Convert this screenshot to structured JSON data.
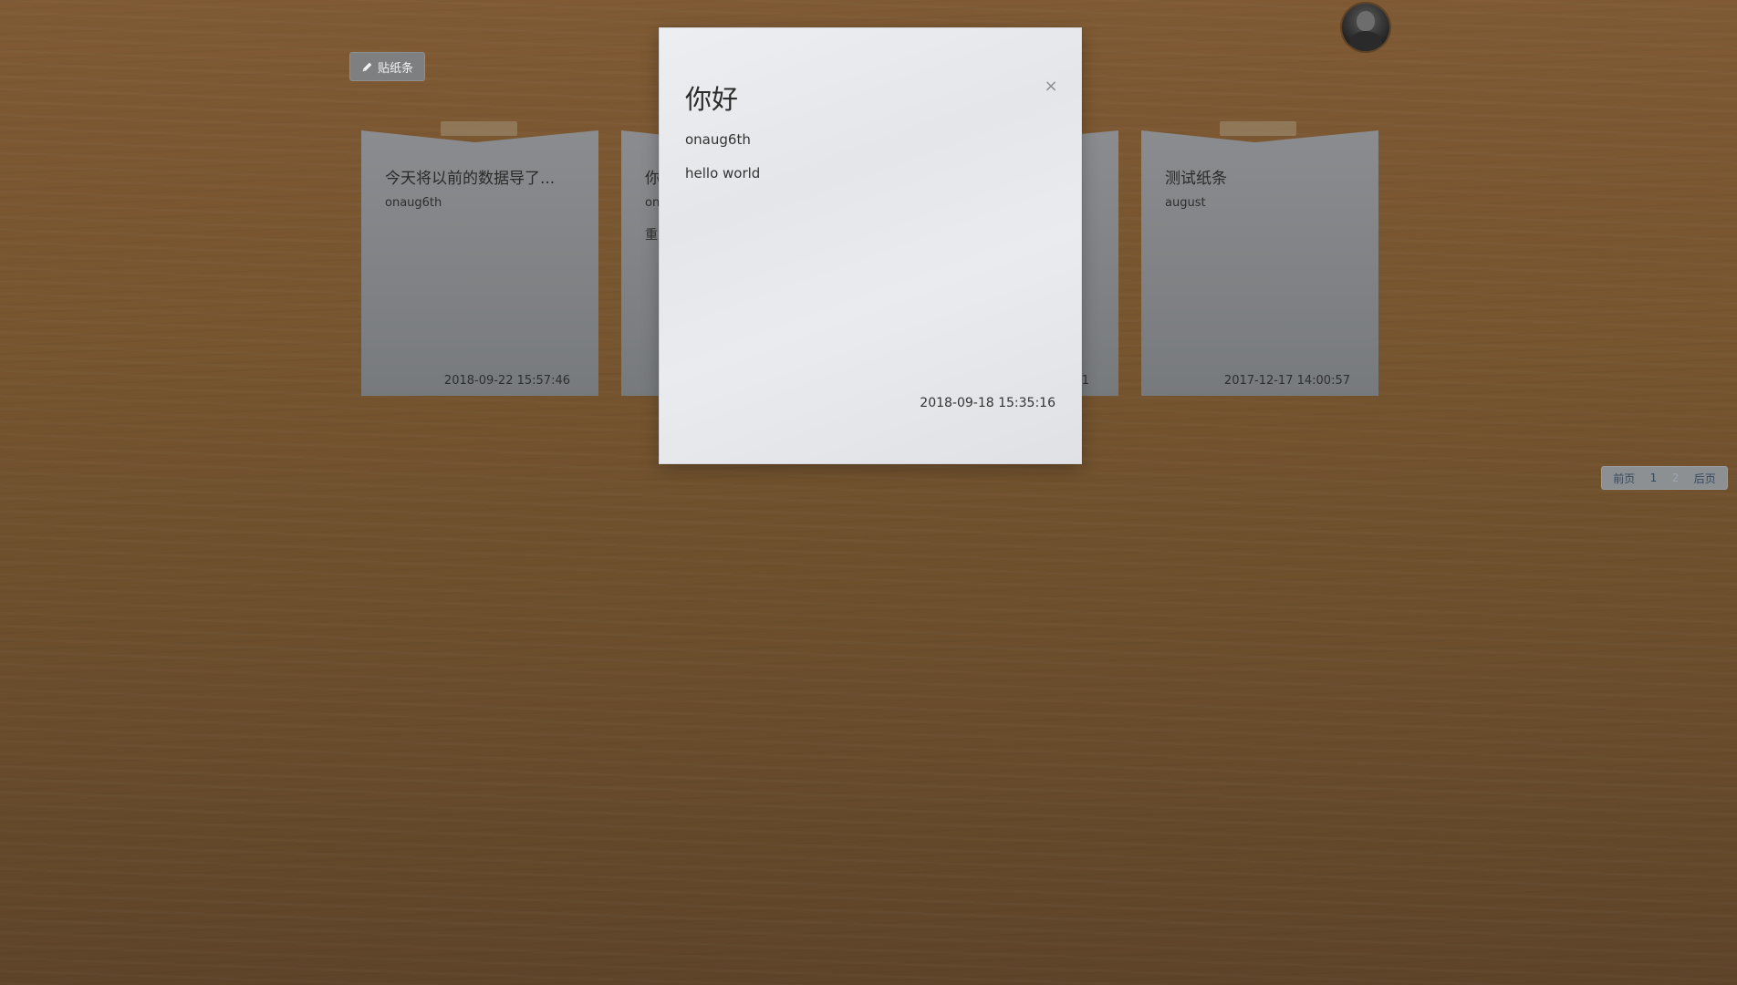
{
  "toolbar": {
    "post_label": "贴纸条"
  },
  "notes": [
    {
      "title": "今天将以前的数据导了...",
      "author": "onaug6th",
      "extra": "",
      "date": "2018-09-22 15:57:46"
    },
    {
      "title": "你",
      "author": "on",
      "extra": "重",
      "date": ""
    },
    {
      "title": "",
      "author": "",
      "extra": "",
      "date": "21"
    },
    {
      "title": "测试纸条",
      "author": "august",
      "extra": "",
      "date": "2017-12-17 14:00:57"
    }
  ],
  "modal": {
    "title": "你好",
    "close": "×",
    "author": "onaug6th",
    "content": "hello world",
    "date": "2018-09-18 15:35:16"
  },
  "pagination": {
    "prev": "前页",
    "page1": "1",
    "page2": "2",
    "next": "后页"
  }
}
